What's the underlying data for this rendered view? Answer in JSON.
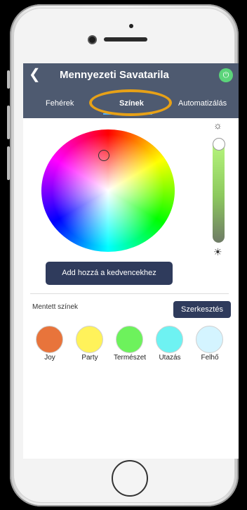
{
  "header": {
    "back_icon": "chevron-left-icon",
    "title": "Mennyezeti Savatarila",
    "power_icon": "power-icon",
    "power_color": "#5bd47a",
    "background": "#4e5a70"
  },
  "tabs": [
    {
      "label": "Fehérek"
    },
    {
      "label": "Színek",
      "selected": true
    },
    {
      "label": "Automatizálás"
    }
  ],
  "brightness": {
    "level": 1.0,
    "top_icon": "sun-icon",
    "bottom_icon": "sun-dim-icon"
  },
  "buttons": {
    "add_favorite": "Add hozzá a kedvencekhez",
    "edit": "Szerkesztés"
  },
  "saved": {
    "label": "Mentett színek",
    "colors": [
      {
        "name": "Joy",
        "color": "#e8743b"
      },
      {
        "name": "Party",
        "color": "#fff25a"
      },
      {
        "name": "Természet",
        "color": "#6df25c"
      },
      {
        "name": "Utazás",
        "color": "#6ef2f2"
      },
      {
        "name": "Felhő",
        "color": "#d4f4ff"
      }
    ]
  },
  "accent": {
    "highlight": "#e7a117",
    "button": "#2f3b5c"
  }
}
